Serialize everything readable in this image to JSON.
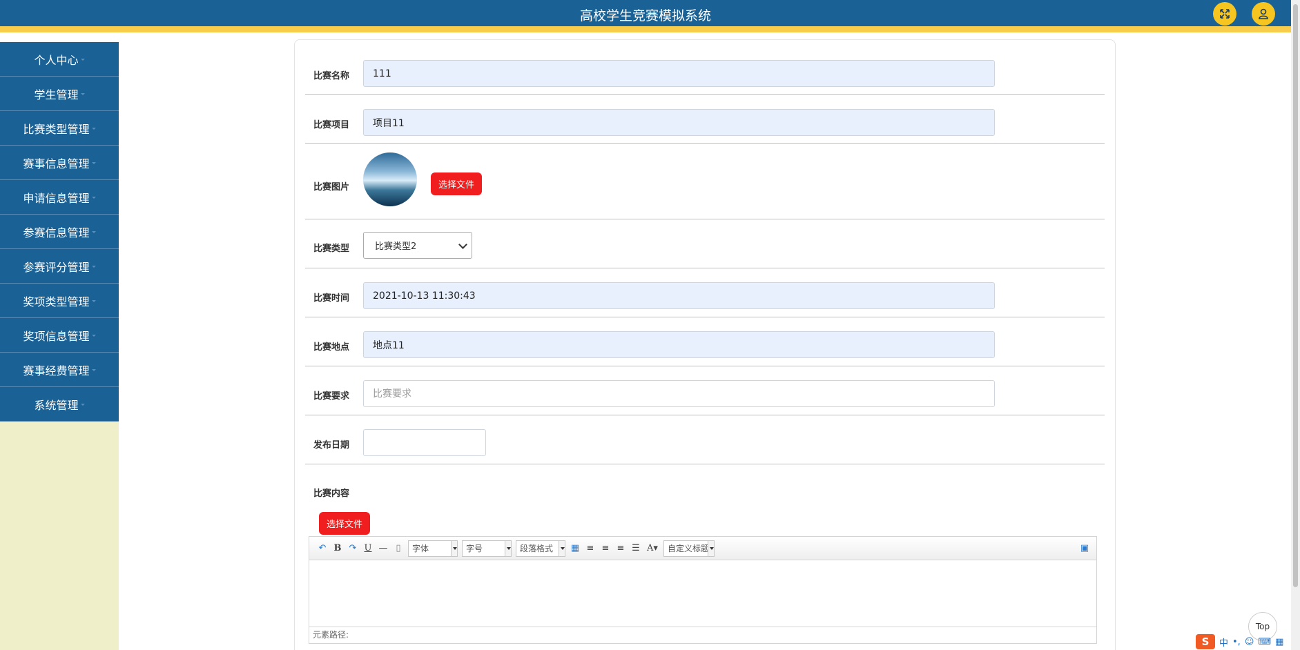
{
  "header": {
    "title": "高校学生竞赛模拟系统",
    "colors": {
      "header_bg": "#1a6196",
      "accent_bar": "#f7cd4b",
      "icon_button": "#f7c520"
    }
  },
  "header_buttons": {
    "fullscreen_icon": "expand-icon",
    "user_icon": "user-icon"
  },
  "sidebar": {
    "items": [
      {
        "label": "个人中心"
      },
      {
        "label": "学生管理"
      },
      {
        "label": "比赛类型管理"
      },
      {
        "label": "赛事信息管理"
      },
      {
        "label": "申请信息管理"
      },
      {
        "label": "参赛信息管理"
      },
      {
        "label": "参赛评分管理"
      },
      {
        "label": "奖项类型管理"
      },
      {
        "label": "奖项信息管理"
      },
      {
        "label": "赛事经费管理"
      },
      {
        "label": "系统管理"
      }
    ]
  },
  "form": {
    "name": {
      "label": "比赛名称",
      "value": "111"
    },
    "project": {
      "label": "比赛项目",
      "value": "项目11"
    },
    "image": {
      "label": "比赛图片",
      "button": "选择文件"
    },
    "type": {
      "label": "比赛类型",
      "selected": "比赛类型2"
    },
    "time": {
      "label": "比赛时间",
      "value": "2021-10-13 11:30:43"
    },
    "location": {
      "label": "比赛地点",
      "value": "地点11"
    },
    "requirement": {
      "label": "比赛要求",
      "placeholder": "比赛要求"
    },
    "publish_date": {
      "label": "发布日期",
      "value": ""
    },
    "content": {
      "label": "比赛内容",
      "button": "选择文件"
    }
  },
  "editor": {
    "font_family": "字体",
    "font_size": "字号",
    "paragraph": "段落格式",
    "custom_title": "自定义标题",
    "font_color_glyph": "A",
    "status_path": "元素路径:"
  },
  "scroll_top": "Top",
  "ime": {
    "logo": "S",
    "lang": "中"
  }
}
